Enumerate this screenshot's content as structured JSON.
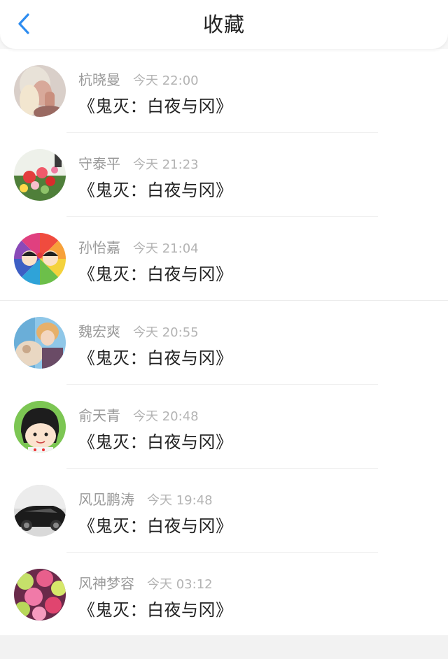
{
  "header": {
    "title": "收藏",
    "back_icon": "chevron-left-icon",
    "accent_color": "#2d8cf0"
  },
  "favorites": [
    {
      "name": "杭晓曼",
      "time": "今天 22:00",
      "content": "《鬼灭：白夜与冈》"
    },
    {
      "name": "守泰平",
      "time": "今天 21:23",
      "content": "《鬼灭：白夜与冈》"
    },
    {
      "name": "孙怡嘉",
      "time": "今天 21:04",
      "content": "《鬼灭：白夜与冈》"
    },
    {
      "name": "魏宏爽",
      "time": "今天 20:55",
      "content": "《鬼灭：白夜与冈》"
    },
    {
      "name": "俞天青",
      "time": "今天 20:48",
      "content": "《鬼灭：白夜与冈》"
    },
    {
      "name": "风见鹏涛",
      "time": "今天 19:48",
      "content": "《鬼灭：白夜与冈》"
    },
    {
      "name": "风神梦容",
      "time": "今天 03:12",
      "content": "《鬼灭：白夜与冈》"
    }
  ]
}
